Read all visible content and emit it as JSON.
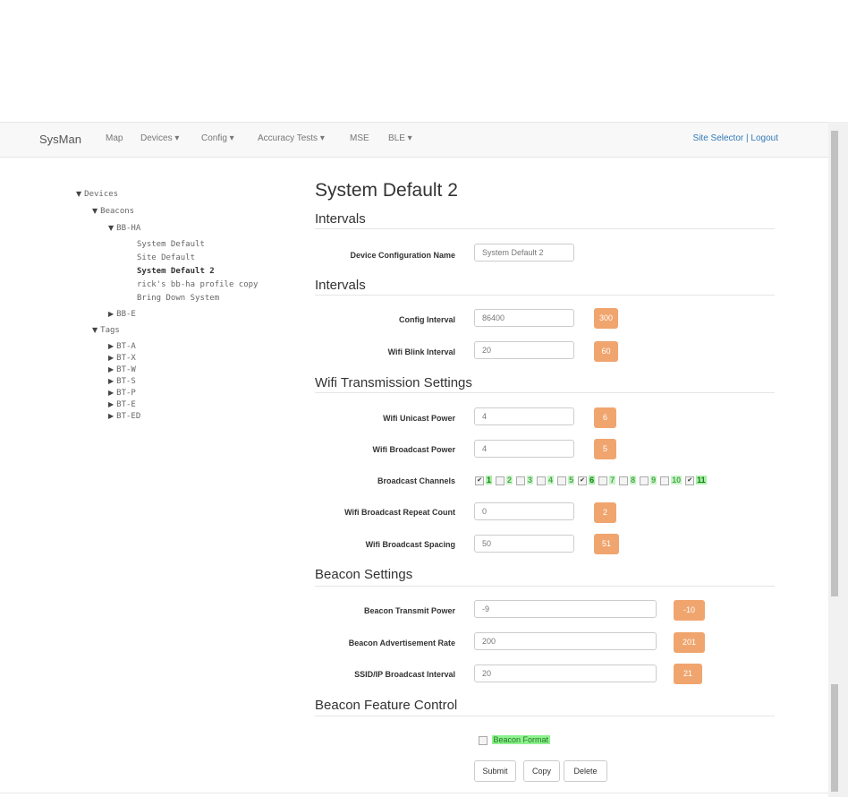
{
  "navbar": {
    "brand": "SysMan",
    "items": [
      {
        "label": "Map"
      },
      {
        "label": "Devices ▾"
      },
      {
        "label": "Config ▾"
      },
      {
        "label": "Accuracy Tests ▾"
      },
      {
        "label": "MSE"
      },
      {
        "label": "BLE ▾"
      }
    ],
    "site_selector": "Site Selector",
    "separator": "|",
    "logout": "Logout"
  },
  "tree": {
    "devices": "Devices",
    "beacons": "Beacons",
    "bbha": "BB-HA",
    "bbha_children": [
      "System Default",
      "Site Default",
      "System Default 2",
      "rick's bb-ha profile copy",
      "Bring Down System"
    ],
    "bbe": "BB-E",
    "tags": "Tags",
    "tag_children": [
      "BT-A",
      "BT-X",
      "BT-W",
      "BT-S",
      "BT-P",
      "BT-E",
      "BT-ED"
    ]
  },
  "main": {
    "title": "System Default 2",
    "sections": {
      "intervals_1": "Intervals",
      "intervals_2": "Intervals",
      "wifi": "Wifi Transmission Settings",
      "beacon": "Beacon Settings",
      "feature": "Beacon Feature Control"
    },
    "fields": {
      "config_name": {
        "label": "Device Configuration Name",
        "value": "System Default 2"
      },
      "config_interval": {
        "label": "Config Interval",
        "value": "86400",
        "badge": "300"
      },
      "wifi_blink": {
        "label": "Wifi Blink Interval",
        "value": "20",
        "badge": "60"
      },
      "wifi_unicast": {
        "label": "Wifi Unicast Power",
        "value": "4",
        "badge": "6"
      },
      "wifi_broadcast": {
        "label": "Wifi Broadcast Power",
        "value": "4",
        "badge": "5"
      },
      "broadcast_channels": {
        "label": "Broadcast Channels"
      },
      "repeat_count": {
        "label": "Wifi Broadcast Repeat Count",
        "value": "0",
        "badge": "2"
      },
      "spacing": {
        "label": "Wifi Broadcast Spacing",
        "value": "50",
        "badge": "51"
      },
      "beacon_tx": {
        "label": "Beacon Transmit Power",
        "value": "-9",
        "badge": "-10"
      },
      "beacon_adv": {
        "label": "Beacon Advertisement Rate",
        "value": "200",
        "badge": "201"
      },
      "ssid": {
        "label": "SSID/IP Broadcast Interval",
        "value": "20",
        "badge": "21"
      }
    },
    "channels": [
      {
        "num": "1",
        "checked": true
      },
      {
        "num": "2",
        "checked": false
      },
      {
        "num": "3",
        "checked": false
      },
      {
        "num": "4",
        "checked": false
      },
      {
        "num": "5",
        "checked": false
      },
      {
        "num": "6",
        "checked": true
      },
      {
        "num": "7",
        "checked": false
      },
      {
        "num": "8",
        "checked": false
      },
      {
        "num": "9",
        "checked": false
      },
      {
        "num": "10",
        "checked": false
      },
      {
        "num": "11",
        "checked": true
      }
    ],
    "beacon_format": {
      "label": "Beacon Format",
      "checked": false
    },
    "buttons": {
      "submit": "Submit",
      "copy": "Copy",
      "delete": "Delete"
    }
  },
  "colors": {
    "badge": "#f0a56e",
    "highlight": "#8ef08e",
    "link": "#337ab7"
  }
}
